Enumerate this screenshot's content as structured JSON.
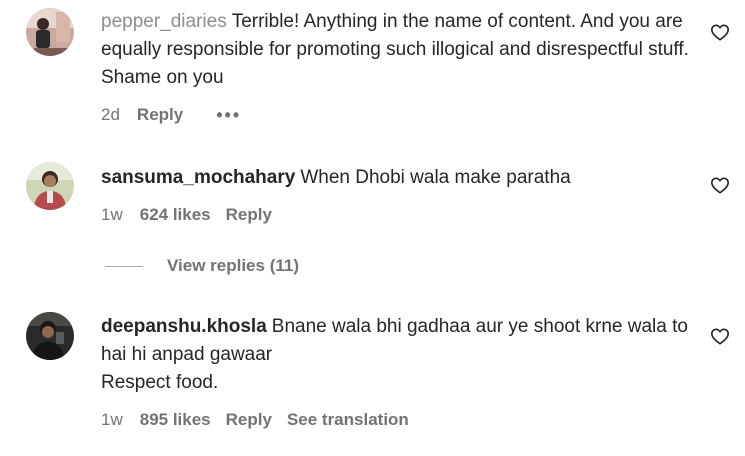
{
  "comments": [
    {
      "username": "pepper_diaries",
      "text": "Terrible! Anything in the name of content. And you are equally responsible for promoting such illogical and disrespectful stuff. Shame on you",
      "time": "2d",
      "reply_label": "Reply",
      "more_icon": "more-horizontal-icon"
    },
    {
      "username": "sansuma_mochahary",
      "text": "When Dhobi wala make paratha",
      "time": "1w",
      "likes": "624 likes",
      "reply_label": "Reply",
      "view_replies": "View replies (11)"
    },
    {
      "username": "deepanshu.khosla",
      "text_line1": "Bnane wala bhi gadhaa aur ye shoot krne wala to hai hi anpad gawaar",
      "text_line2": "Respect food.",
      "time": "1w",
      "likes": "895 likes",
      "reply_label": "Reply",
      "translation_label": "See translation"
    }
  ],
  "icons": {
    "like": "heart-outline-icon",
    "avatar": "user-avatar"
  },
  "colors": {
    "text_primary": "#262626",
    "text_secondary": "#737373",
    "username_faded": "#8e8e8e"
  }
}
